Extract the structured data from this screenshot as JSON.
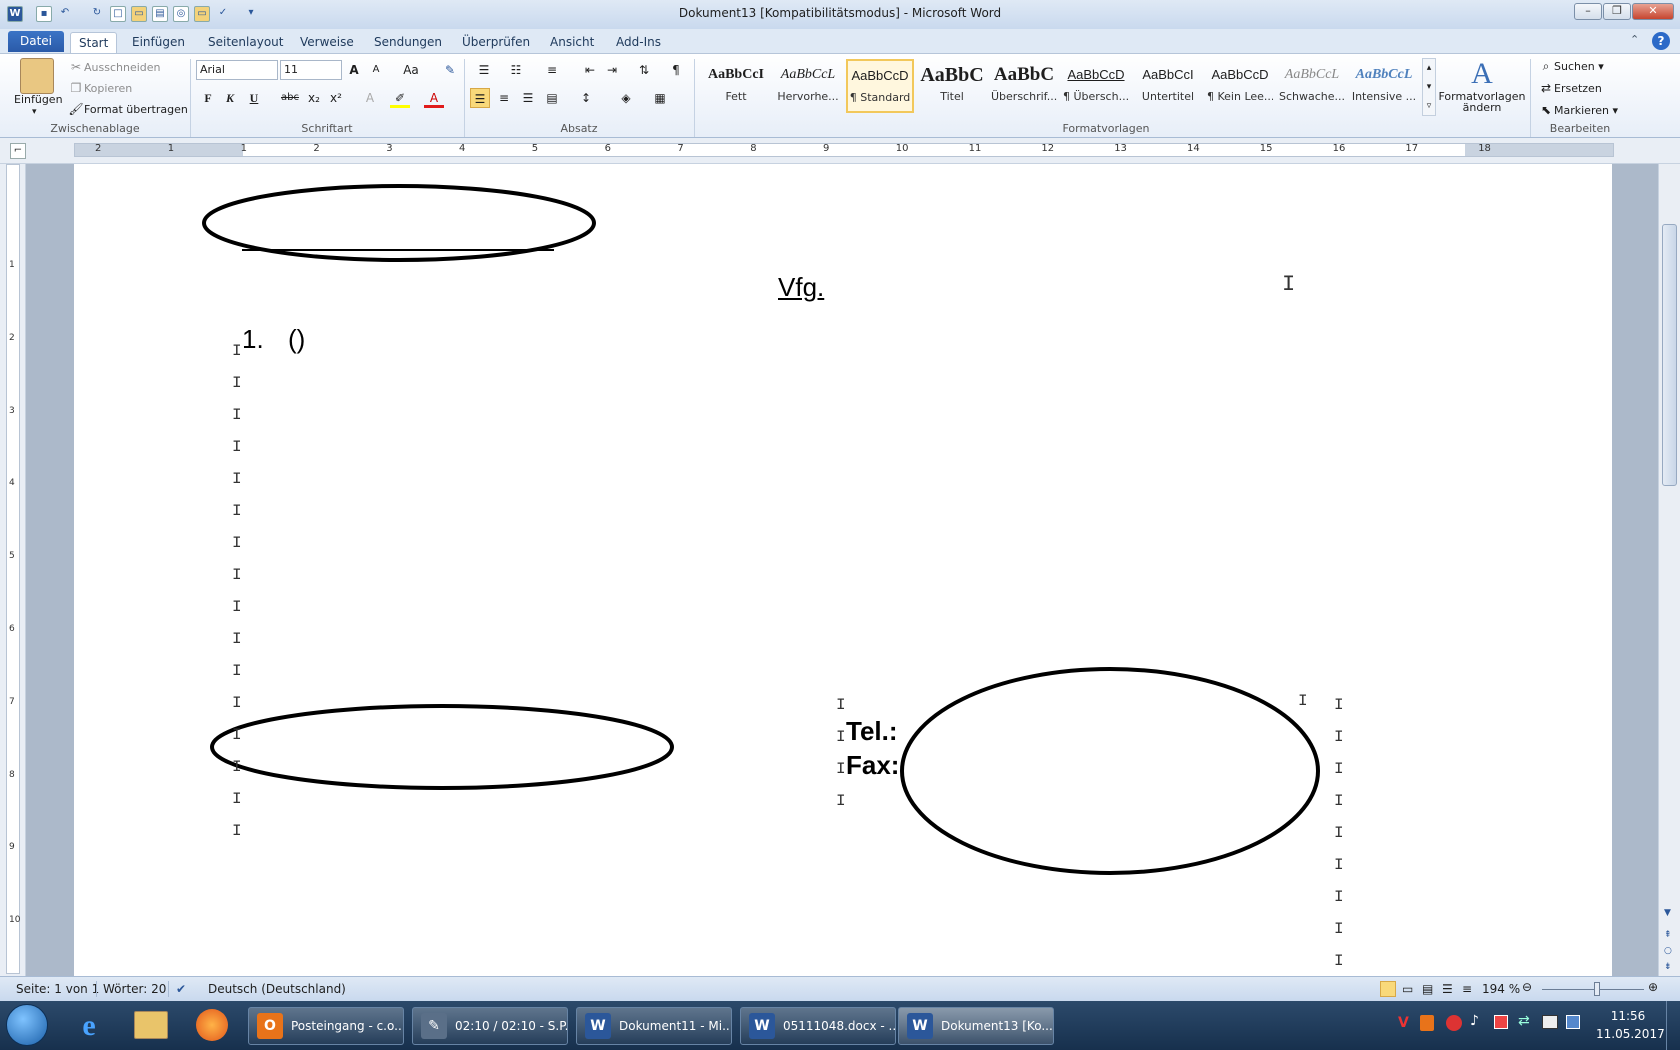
{
  "window": {
    "title": "Dokument13 [Kompatibilitätsmodus] - Microsoft Word",
    "app_icon": "W"
  },
  "tabs": {
    "file": "Datei",
    "items": [
      "Start",
      "Einfügen",
      "Seitenlayout",
      "Verweise",
      "Sendungen",
      "Überprüfen",
      "Ansicht",
      "Add-Ins"
    ]
  },
  "clipboard": {
    "paste": "Einfügen",
    "cut": "Ausschneiden",
    "copy": "Kopieren",
    "format_painter": "Format übertragen",
    "group": "Zwischenablage"
  },
  "font": {
    "name": "Arial",
    "size": "11",
    "group": "Schriftart",
    "bold": "F",
    "italic": "K",
    "underline": "U",
    "strike": "abc",
    "sub": "x₂",
    "sup": "x²",
    "grow": "A",
    "shrink": "A",
    "case": "Aa"
  },
  "paragraph": {
    "group": "Absatz",
    "pilcrow": "¶"
  },
  "styles": {
    "group": "Formatvorlagen",
    "items": [
      {
        "preview": "AaBbCcI",
        "name": "Fett"
      },
      {
        "preview": "AaBbCcL",
        "name": "Hervorhe..."
      },
      {
        "preview": "AaBbCcD",
        "name": "¶ Standard"
      },
      {
        "preview": "AaBbC",
        "name": "Titel"
      },
      {
        "preview": "AaBbC",
        "name": "Überschrif..."
      },
      {
        "preview": "AaBbCcD",
        "name": "¶ Übersch..."
      },
      {
        "preview": "AaBbCcI",
        "name": "Untertitel"
      },
      {
        "preview": "AaBbCcD",
        "name": "¶ Kein Lee..."
      },
      {
        "preview": "AaBbCcL",
        "name": "Schwache..."
      },
      {
        "preview": "AaBbCcL",
        "name": "Intensive ..."
      }
    ],
    "change_line1": "Formatvorlagen",
    "change_line2": "ändern"
  },
  "editing": {
    "group": "Bearbeiten",
    "find": "Suchen",
    "replace": "Ersetzen",
    "select": "Markieren"
  },
  "ruler": {
    "h_ticks": [
      "2",
      "1",
      "1",
      "2",
      "3",
      "4",
      "5",
      "6",
      "7",
      "8",
      "9",
      "10",
      "11",
      "12",
      "13",
      "14",
      "15",
      "16",
      "17",
      "18"
    ],
    "v_ticks": [
      "1",
      "2",
      "3",
      "4",
      "5",
      "6",
      "7",
      "8",
      "9",
      "10"
    ]
  },
  "document": {
    "heading": "Vfg.",
    "list_number": "1.",
    "list_text": "()",
    "tel_label": "Tel.:",
    "fax_label": "Fax:"
  },
  "status": {
    "page": "Seite: 1 von 1",
    "words": "Wörter: 20",
    "language": "Deutsch (Deutschland)",
    "zoom": "194 %"
  },
  "taskbar": {
    "buttons": [
      {
        "label": "Posteingang - c.o...",
        "icon": "O",
        "color": "#e8731a"
      },
      {
        "label": "02:10 / 02:10 - S.P...",
        "icon": "✎",
        "color": "#5a6f88"
      },
      {
        "label": "Dokument11 - Mi...",
        "icon": "W",
        "color": "#2b579a"
      },
      {
        "label": "05111048.docx - ...",
        "icon": "W",
        "color": "#2b579a"
      },
      {
        "label": "Dokument13 [Ko...",
        "icon": "W",
        "color": "#2b579a"
      }
    ],
    "time": "11:56",
    "date": "11.05.2017"
  }
}
